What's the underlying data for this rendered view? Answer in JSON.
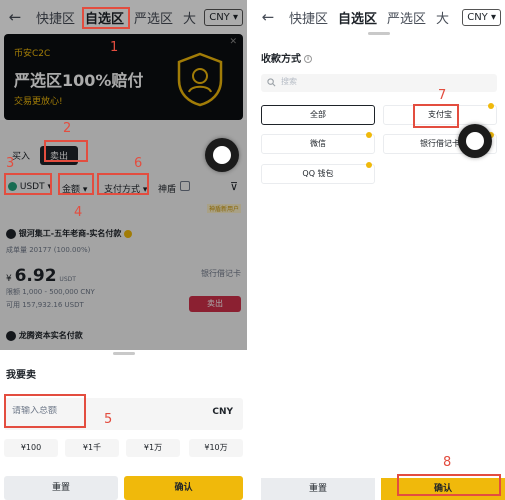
{
  "left": {
    "nav": {
      "back": "←",
      "tabs": [
        "快捷区",
        "自选区",
        "严选区",
        "大"
      ],
      "currency": "CNY ▾"
    },
    "banner": {
      "brand": "币安C2C",
      "headline": "严选区100%赔付",
      "sub": "交易更放心!"
    },
    "trade_tabs": {
      "buy": "买入",
      "sell": "卖出"
    },
    "filters": {
      "coin": "USDT",
      "amount": "金额",
      "payment": "支付方式",
      "god": "神盾"
    },
    "seller1": {
      "name": "银河集工-五年老商-实名付款",
      "stats": "成单量 20177 (100.00%)",
      "price": "6.92",
      "price_unit": "USDT",
      "limits": "限额 1,000 - 500,000 CNY",
      "avail": "可用 157,932.16 USDT",
      "method": "银行借记卡",
      "sell_btn": "卖出",
      "promo": "神盾新用户"
    },
    "seller2": {
      "name": "龙腾资本实名付款"
    },
    "sheet": {
      "title": "我要卖",
      "amount_placeholder": "请输入总额",
      "currency": "CNY",
      "quick": [
        "¥100",
        "¥1千",
        "¥1万",
        "¥10万"
      ],
      "reset": "重置",
      "confirm": "确认"
    }
  },
  "right": {
    "nav": {
      "back": "←",
      "tabs": [
        "快捷区",
        "自选区",
        "严选区",
        "大"
      ],
      "currency": "CNY ▾"
    },
    "title": "收款方式",
    "search_placeholder": "搜索",
    "options": [
      "全部",
      "支付宝",
      "微信",
      "银行借记卡",
      "QQ 钱包"
    ],
    "reset": "重置",
    "confirm": "确认"
  },
  "annotations": [
    "1",
    "2",
    "3",
    "4",
    "5",
    "6",
    "7",
    "8"
  ],
  "colors": {
    "accent": "#f0b90b",
    "annotation": "#e34d3f",
    "sell": "#cf304a",
    "dark": "#1e2329"
  }
}
